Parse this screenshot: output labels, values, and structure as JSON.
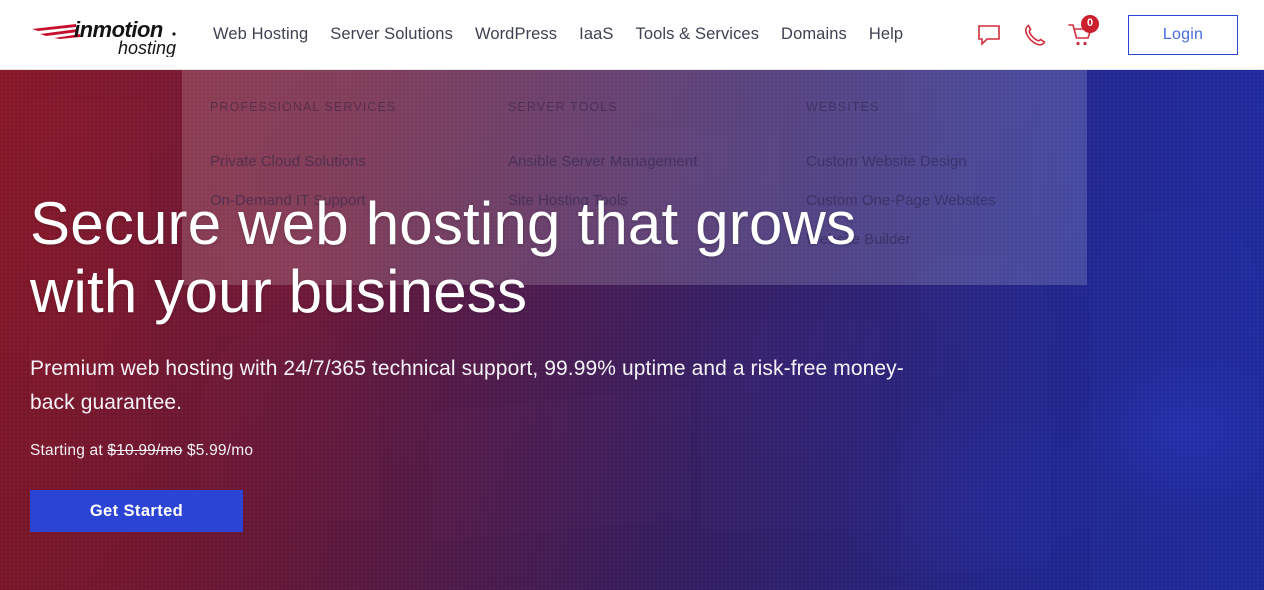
{
  "header": {
    "logo": {
      "name": "inmotion",
      "tagline": "hosting"
    },
    "nav": [
      {
        "label": "Web Hosting"
      },
      {
        "label": "Server Solutions"
      },
      {
        "label": "WordPress"
      },
      {
        "label": "IaaS"
      },
      {
        "label": "Tools & Services"
      },
      {
        "label": "Domains"
      },
      {
        "label": "Help"
      }
    ],
    "icons": [
      {
        "name": "chat-icon"
      },
      {
        "name": "phone-icon"
      },
      {
        "name": "cart-icon",
        "badge": "0"
      }
    ],
    "login_label": "Login"
  },
  "dropdown": {
    "columns": [
      {
        "heading": "PROFESSIONAL SERVICES",
        "links": [
          {
            "label": "Private Cloud Solutions"
          },
          {
            "label": "On-Demand IT Support"
          }
        ]
      },
      {
        "heading": "SERVER TOOLS",
        "links": [
          {
            "label": "Ansible Server Management"
          },
          {
            "label": "Site Hosting Tools"
          }
        ]
      },
      {
        "heading": "WEBSITES",
        "links": [
          {
            "label": "Custom Website Design"
          },
          {
            "label": "Custom One-Page Websites"
          },
          {
            "label": "Website Builder"
          }
        ]
      }
    ]
  },
  "hero": {
    "headline_line1": "Secure web hosting that grows",
    "headline_line2": "with your business",
    "subhead": "Premium web hosting with 24/7/365 technical support, 99.99% uptime and a risk-free money-back guarantee.",
    "price_prefix": "Starting at",
    "price_old": "$10.99/mo",
    "price_new": "$5.99/mo",
    "cta_label": "Get Started"
  },
  "colors": {
    "brand_red": "#cc1f2d",
    "cta_blue": "#2b44d4",
    "login_border": "#2b4ad4",
    "nav_text": "#3d4152",
    "gradient_start": "#b01b2e",
    "gradient_end": "#2a37c4"
  }
}
